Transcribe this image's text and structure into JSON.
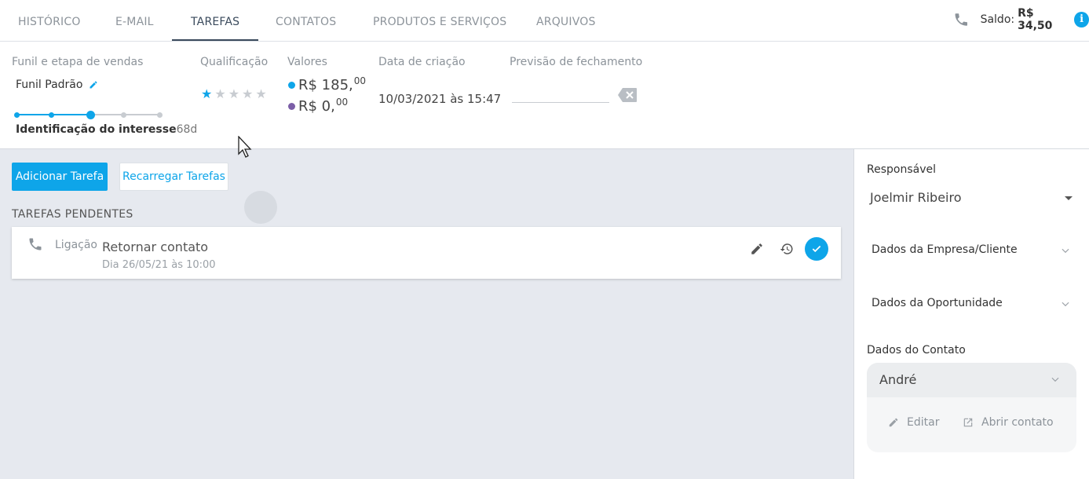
{
  "tabs": [
    {
      "label": "HISTÓRICO",
      "active": false
    },
    {
      "label": "E-MAIL",
      "active": false
    },
    {
      "label": "TAREFAS",
      "active": true
    },
    {
      "label": "CONTATOS",
      "active": false
    },
    {
      "label": "PRODUTOS E SERVIÇOS",
      "active": false
    },
    {
      "label": "ARQUIVOS",
      "active": false
    }
  ],
  "saldo": {
    "label": "Saldo:",
    "value": "R$ 34,50",
    "icon": "info-icon"
  },
  "deal": {
    "funnel_label": "Funil e etapa de vendas",
    "funnel_name": "Funil Padrão",
    "stage_count": 5,
    "current_stage_index": 2,
    "stage_name": "Identificação do interesse",
    "stage_days": "68d",
    "qualification_label": "Qualificação",
    "rating": 1,
    "rating_max": 5,
    "values_label": "Valores",
    "value_1": {
      "main": "R$ 185,",
      "cents": "00",
      "color": "#0ea5e9"
    },
    "value_2": {
      "main": "R$ 0,",
      "cents": "00",
      "color": "#7b5ea7"
    },
    "created_label": "Data de criação",
    "created_value": "10/03/2021 às 15:47",
    "close_label": "Previsão de fechamento",
    "close_value": ""
  },
  "actions": {
    "add_task": "Adicionar Tarefa",
    "reload_tasks": "Recarregar Tarefas"
  },
  "pending": {
    "title": "TAREFAS PENDENTES",
    "tasks": [
      {
        "type": "Ligação",
        "title": "Retornar contato",
        "date": "Dia 26/05/21 às 10:00"
      }
    ]
  },
  "side": {
    "owner_label": "Responsável",
    "owner_value": "Joelmir Ribeiro",
    "company_section": "Dados da Empresa/Cliente",
    "opportunity_section": "Dados da Oportunidade",
    "contact_label": "Dados do Contato",
    "contact_name": "André",
    "edit_label": "Editar",
    "open_contact_label": "Abrir contato"
  },
  "colors": {
    "accent": "#0ea5e9",
    "active_tab": "#3a4a5c"
  }
}
